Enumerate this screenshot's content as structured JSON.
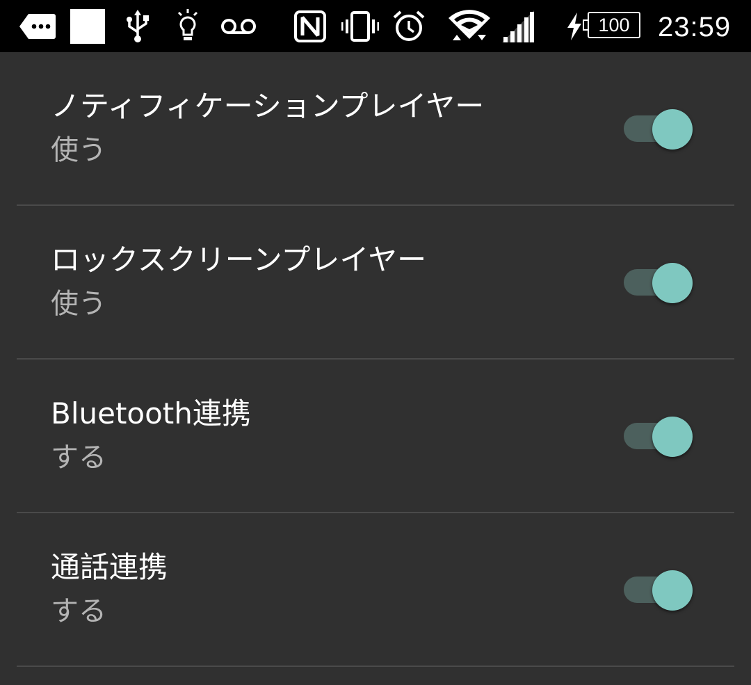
{
  "status_bar": {
    "icons": [
      "more-notifications-icon",
      "notification-square-icon",
      "usb-icon",
      "lightbulb-icon",
      "voicemail-icon",
      "nfc-icon",
      "vibrate-icon",
      "alarm-icon",
      "wifi-icon",
      "cell-signal-icon",
      "charging-icon"
    ],
    "battery_level": "100",
    "time": "23:59"
  },
  "colors": {
    "background": "#303030",
    "divider": "#4a4a4a",
    "summary_text": "#b4b4b4",
    "toggle_thumb_on": "#7fc8c0",
    "toggle_track_on": "#4c605d"
  },
  "settings": [
    {
      "title": "ノティフィケーションプレイヤー",
      "summary": "使う",
      "enabled": true
    },
    {
      "title": "ロックスクリーンプレイヤー",
      "summary": "使う",
      "enabled": true
    },
    {
      "title": "Bluetooth連携",
      "summary": "する",
      "enabled": true
    },
    {
      "title": "通話連携",
      "summary": "する",
      "enabled": true
    }
  ]
}
